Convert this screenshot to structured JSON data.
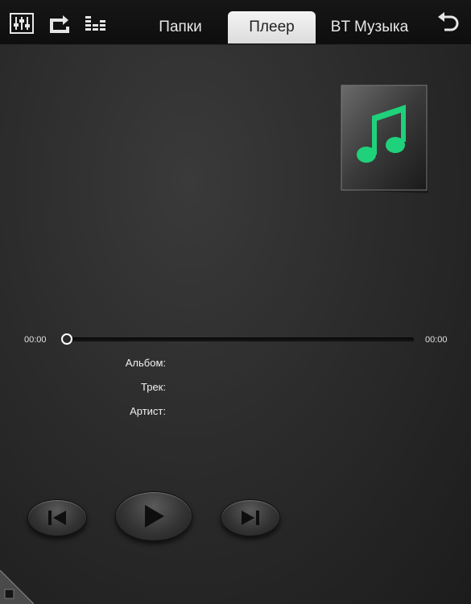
{
  "toolbar": {
    "icons": [
      "mixer-icon",
      "repeat-icon",
      "equalizer-icon",
      "back-icon"
    ]
  },
  "tabs": [
    {
      "label": "Папки",
      "active": false
    },
    {
      "label": "Плеер",
      "active": true
    },
    {
      "label": "BT Музыка",
      "active": false
    }
  ],
  "player": {
    "elapsed": "00:00",
    "duration": "00:00",
    "progress": 0,
    "album_label": "Альбом:",
    "album_value": "",
    "track_label": "Трек:",
    "track_value": "",
    "artist_label": "Артист:",
    "artist_value": ""
  },
  "controls": {
    "icons": [
      "previous-icon",
      "play-icon",
      "next-icon"
    ]
  },
  "colors": {
    "accent_note": "#1fd17a",
    "background": "#2a2a2a",
    "tab_active": "#e8e8e8"
  }
}
